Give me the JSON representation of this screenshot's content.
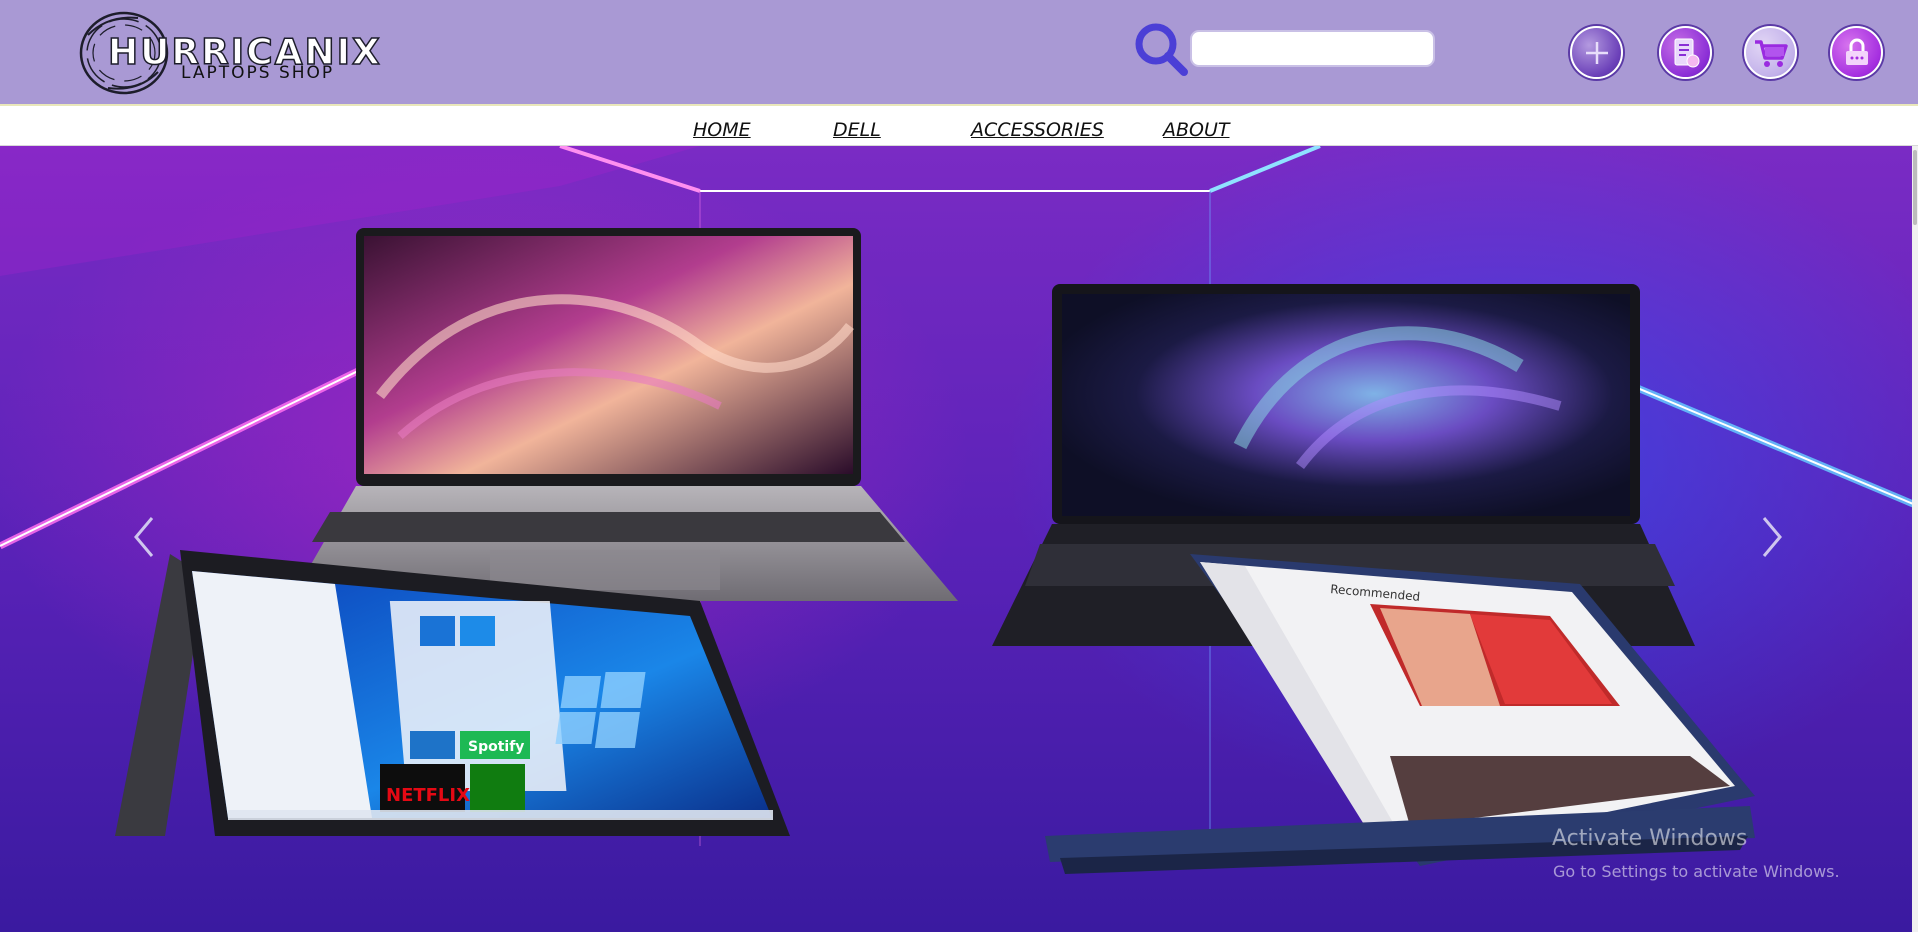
{
  "header": {
    "brand": {
      "title": "HURRICANIX",
      "subtitle": "LAPTOPS SHOP"
    },
    "search": {
      "placeholder": "",
      "value": ""
    },
    "icons": {
      "add": "plus-icon",
      "list": "document-list-icon",
      "cart": "cart-icon",
      "account": "lock-icon"
    }
  },
  "nav": {
    "items": [
      {
        "label": "HOME"
      },
      {
        "label": "DELL"
      },
      {
        "label": "ACCESSORIES"
      },
      {
        "label": "ABOUT"
      }
    ]
  },
  "hero": {
    "prev_icon": "chevron-left-icon",
    "next_icon": "chevron-right-icon",
    "laptops": [
      {
        "name": "silver-laptop",
        "wallpaper": "purple-swirl"
      },
      {
        "name": "black-laptop",
        "wallpaper": "nebula"
      },
      {
        "name": "tent-laptop",
        "wallpaper": "windows-start"
      },
      {
        "name": "convertible-laptop",
        "wallpaper": "music-app"
      }
    ],
    "start_tiles": [
      "Spotify",
      "NETFLIX"
    ],
    "app_heading": "Recommended"
  },
  "watermark": {
    "title": "Activate Windows",
    "subtitle": "Go to Settings to activate Windows."
  },
  "colors": {
    "header_bg": "#a999d4",
    "accent": "#5b3aa6",
    "search_icon": "#4b3fd6"
  }
}
